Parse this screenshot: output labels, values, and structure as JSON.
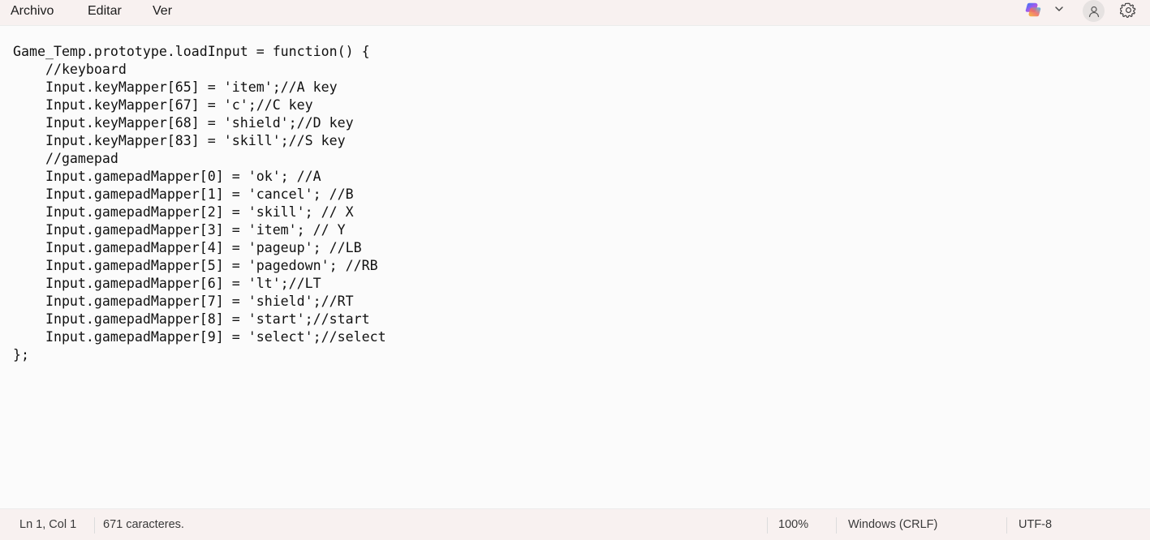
{
  "menu": {
    "file": "Archivo",
    "edit": "Editar",
    "view": "Ver"
  },
  "toolbar": {
    "copilot_icon": "copilot-icon",
    "account_icon": "person-icon",
    "settings_icon": "gear-icon"
  },
  "editor": {
    "lines": [
      "Game_Temp.prototype.loadInput = function() {",
      "    //keyboard",
      "    Input.keyMapper[65] = 'item';//A key",
      "    Input.keyMapper[67] = 'c';//C key",
      "    Input.keyMapper[68] = 'shield';//D key",
      "    Input.keyMapper[83] = 'skill';//S key",
      "    //gamepad",
      "    Input.gamepadMapper[0] = 'ok'; //A",
      "    Input.gamepadMapper[1] = 'cancel'; //B",
      "    Input.gamepadMapper[2] = 'skill'; // X",
      "    Input.gamepadMapper[3] = 'item'; // Y",
      "    Input.gamepadMapper[4] = 'pageup'; //LB",
      "    Input.gamepadMapper[5] = 'pagedown'; //RB",
      "    Input.gamepadMapper[6] = 'lt';//LT",
      "    Input.gamepadMapper[7] = 'shield';//RT",
      "    Input.gamepadMapper[8] = 'start';//start",
      "    Input.gamepadMapper[9] = 'select';//select",
      "};"
    ]
  },
  "status": {
    "position": "Ln 1, Col 1",
    "chars": "671 caracteres.",
    "zoom": "100%",
    "line_ending": "Windows (CRLF)",
    "encoding": "UTF-8"
  },
  "colors": {
    "chrome_bg": "#f8f1f0",
    "editor_bg": "#fbfbfb"
  }
}
